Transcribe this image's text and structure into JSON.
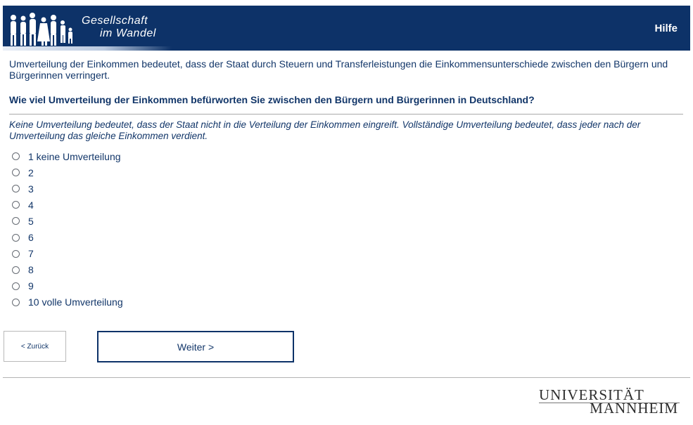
{
  "header": {
    "logo_line1": "Gesellschaft",
    "logo_line2": "im Wandel",
    "help_label": "Hilfe",
    "background_color": "#0d3268"
  },
  "intro_text": "Umverteilung der Einkommen bedeutet, dass der Staat durch Steuern und Transferleistungen die Einkommensunterschiede zwischen den Bürgern und Bürgerinnen verringert.",
  "question": "Wie viel Umverteilung der Einkommen befürworten Sie zwischen den Bürgern und Bürgerinnen in Deutschland?",
  "instruction": "Keine Umverteilung bedeutet, dass der Staat nicht in die Verteilung der Einkommen eingreift. Vollständige Umverteilung bedeutet, dass jeder nach der Umverteilung das gleiche Einkommen verdient.",
  "options": [
    "1 keine Umverteilung",
    "2",
    "3",
    "4",
    "5",
    "6",
    "7",
    "8",
    "9",
    "10 volle Umverteilung"
  ],
  "selected_option": null,
  "buttons": {
    "back_label": "< Zurück",
    "next_label": "Weiter >"
  },
  "footer": {
    "logo_line1": "UNIVERSITÄT",
    "logo_line2": "MANNHEIM"
  }
}
